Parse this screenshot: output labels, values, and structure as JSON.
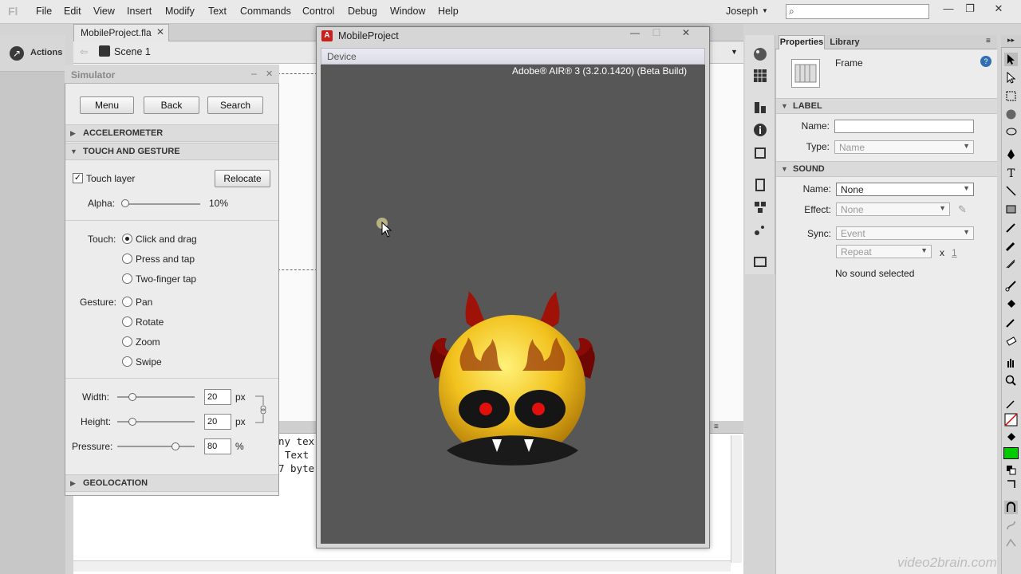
{
  "menubar": {
    "logo": "Fl",
    "items": [
      "File",
      "Edit",
      "View",
      "Insert",
      "Modify",
      "Text",
      "Commands",
      "Control",
      "Debug",
      "Window",
      "Help"
    ],
    "user": "Joseph",
    "search_placeholder": ""
  },
  "actions": {
    "label": "Actions"
  },
  "document": {
    "tab_label": "MobileProject.fla",
    "scene_label": "Scene 1"
  },
  "code_panel": {
    "lines": [
      "ny tex",
      "Text",
      "7 byte"
    ]
  },
  "simulator": {
    "title": "Simulator",
    "buttons": {
      "menu": "Menu",
      "back": "Back",
      "search": "Search"
    },
    "sections": {
      "accelerometer": "ACCELEROMETER",
      "touch_gesture": "TOUCH AND GESTURE",
      "geolocation": "GEOLOCATION"
    },
    "touch_layer": {
      "label": "Touch layer",
      "checked": true,
      "relocate": "Relocate"
    },
    "alpha": {
      "label": "Alpha:",
      "value": "10%",
      "level": 0.0
    },
    "touch": {
      "label": "Touch:",
      "options": [
        "Click and drag",
        "Press and tap",
        "Two-finger tap"
      ],
      "selected": "Click and drag"
    },
    "gesture": {
      "label": "Gesture:",
      "options": [
        "Pan",
        "Rotate",
        "Zoom",
        "Swipe"
      ]
    },
    "width": {
      "label": "Width:",
      "value": "20",
      "unit": "px"
    },
    "height": {
      "label": "Height:",
      "value": "20",
      "unit": "px"
    },
    "pressure": {
      "label": "Pressure:",
      "value": "80",
      "unit": "%"
    }
  },
  "device_window": {
    "title": "MobileProject",
    "menu": "Device",
    "banner": "Adobe® AIR® 3 (3.2.0.1420) (Beta Build)"
  },
  "properties": {
    "tabs": {
      "properties": "Properties",
      "library": "Library"
    },
    "frame_label": "Frame",
    "label_section": {
      "title": "LABEL",
      "name_label": "Name:",
      "name_value": "",
      "type_label": "Type:",
      "type_value": "Name"
    },
    "sound_section": {
      "title": "SOUND",
      "name_label": "Name:",
      "name_value": "None",
      "effect_label": "Effect:",
      "effect_value": "None",
      "sync_label": "Sync:",
      "sync_value": "Event",
      "repeat_value": "Repeat",
      "repeat_x": "x",
      "repeat_count": "1",
      "status": "No sound selected"
    }
  },
  "watermark": "video2brain.com",
  "colors": {
    "device_screen": "#575757",
    "accent_red": "#c8201b",
    "fill_swatch": "#00cc00"
  }
}
